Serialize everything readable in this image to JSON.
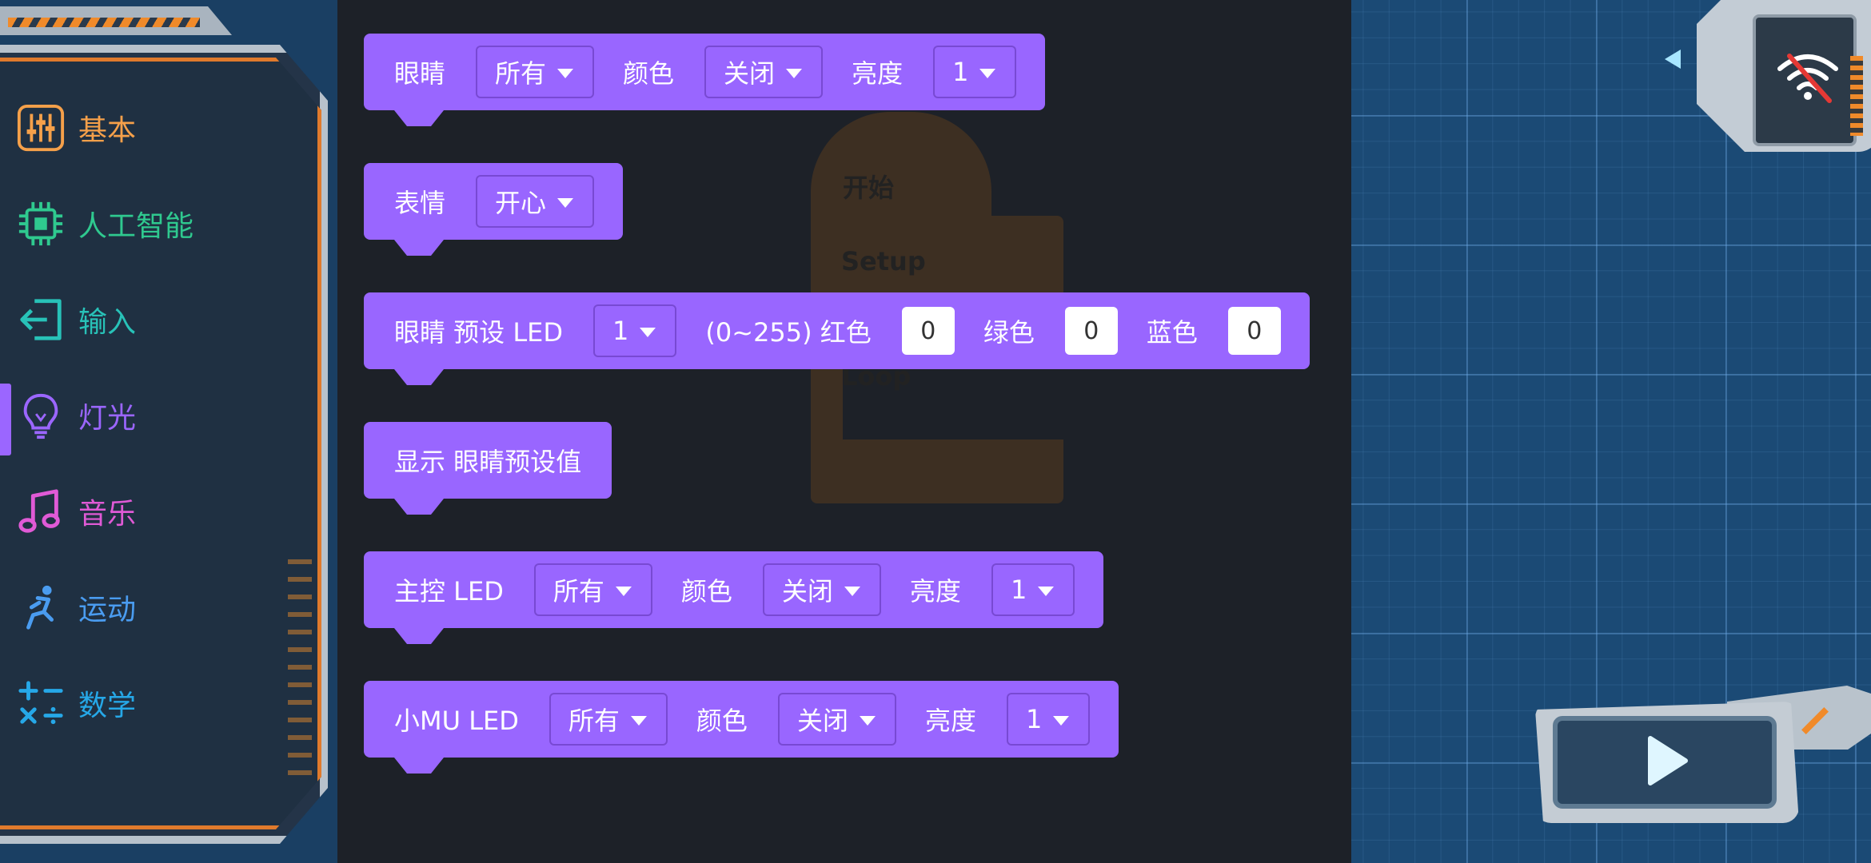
{
  "categories": [
    {
      "id": "basic",
      "label": "基本",
      "icon": "sliders-icon",
      "color": "#f5a04a"
    },
    {
      "id": "ai",
      "label": "人工智能",
      "icon": "chip-icon",
      "color": "#2fc98f"
    },
    {
      "id": "input",
      "label": "输入",
      "icon": "enter-icon",
      "color": "#28c2b8"
    },
    {
      "id": "light",
      "label": "灯光",
      "icon": "bulb-icon",
      "color": "#9b66ff",
      "active": true
    },
    {
      "id": "music",
      "label": "音乐",
      "icon": "music-note-icon",
      "color": "#e05ad6"
    },
    {
      "id": "motion",
      "label": "运动",
      "icon": "runner-icon",
      "color": "#4a9cf0"
    },
    {
      "id": "math",
      "label": "数学",
      "icon": "math-ops-icon",
      "color": "#26a8e8"
    }
  ],
  "ghost_block": {
    "start": "开始",
    "setup": "Setup",
    "loop": "Loop"
  },
  "blocks": [
    {
      "label": "眼睛",
      "fields": [
        {
          "type": "dropdown",
          "value": "所有"
        },
        {
          "type": "label",
          "value": "颜色"
        },
        {
          "type": "dropdown",
          "value": "关闭"
        },
        {
          "type": "label",
          "value": "亮度"
        },
        {
          "type": "dropdown",
          "value": "1"
        }
      ]
    },
    {
      "label": "表情",
      "fields": [
        {
          "type": "dropdown",
          "value": "开心"
        }
      ]
    },
    {
      "label": "眼睛 预设 LED",
      "fields": [
        {
          "type": "dropdown",
          "value": "1"
        },
        {
          "type": "label",
          "value": "(0~255) 红色"
        },
        {
          "type": "number",
          "value": "0"
        },
        {
          "type": "label",
          "value": "绿色"
        },
        {
          "type": "number",
          "value": "0"
        },
        {
          "type": "label",
          "value": "蓝色"
        },
        {
          "type": "number",
          "value": "0"
        }
      ]
    },
    {
      "label": "显示 眼睛预设值",
      "fields": []
    },
    {
      "label": "主控 LED",
      "fields": [
        {
          "type": "dropdown",
          "value": "所有"
        },
        {
          "type": "label",
          "value": "颜色"
        },
        {
          "type": "dropdown",
          "value": "关闭"
        },
        {
          "type": "label",
          "value": "亮度"
        },
        {
          "type": "dropdown",
          "value": "1"
        }
      ]
    },
    {
      "label": "小MU LED",
      "fields": [
        {
          "type": "dropdown",
          "value": "所有"
        },
        {
          "type": "label",
          "value": "颜色"
        },
        {
          "type": "dropdown",
          "value": "关闭"
        },
        {
          "type": "label",
          "value": "亮度"
        },
        {
          "type": "dropdown",
          "value": "1"
        }
      ]
    }
  ],
  "device": {
    "status_icon": "wifi-off-icon"
  },
  "run": {
    "icon": "play-icon"
  },
  "colors": {
    "block_purple": "#9966ff",
    "flyout_bg": "#1d2128",
    "workspace_bg": "#1b4a75",
    "accent_orange": "#f08a2a"
  }
}
